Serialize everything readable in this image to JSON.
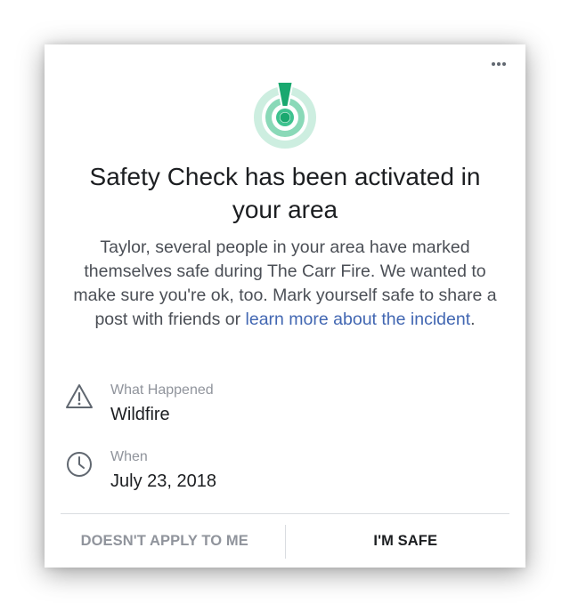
{
  "dialog": {
    "menu_icon": "more-horizontal-icon",
    "hero_icon": "safety-check-icon",
    "accent_color": "#3ec28f",
    "title": "Safety Check has been activated in your area",
    "body_text": "Taylor, several people in your area have marked themselves safe during The Carr Fire. We wanted to make sure you're ok, too. Mark yourself safe to share a post with friends or ",
    "body_link": "learn more about the incident",
    "body_end": ".",
    "link_color": "#4267b2"
  },
  "details": {
    "what": {
      "icon": "warning-triangle-icon",
      "label": "What Happened",
      "value": "Wildfire"
    },
    "when": {
      "icon": "clock-icon",
      "label": "When",
      "value": "July 23, 2018"
    }
  },
  "actions": {
    "decline_label": "DOESN'T APPLY TO ME",
    "confirm_label": "I'M SAFE"
  }
}
